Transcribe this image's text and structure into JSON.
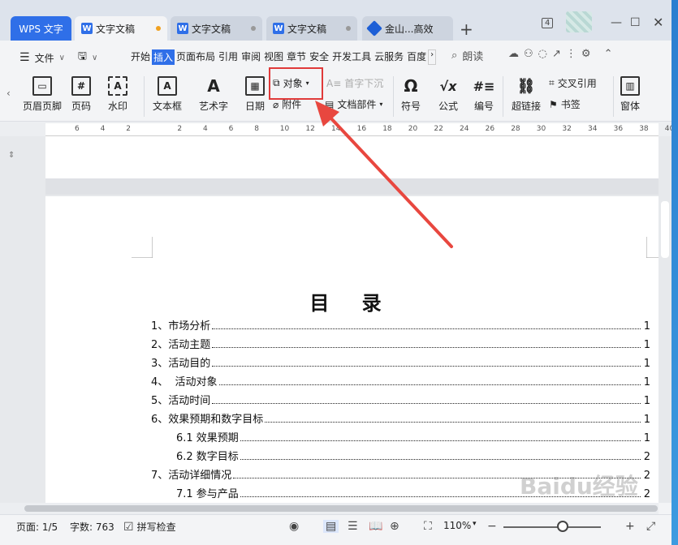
{
  "tabs": [
    {
      "label": "WPS 文字"
    },
    {
      "label": "文字文稿"
    },
    {
      "label": "文字文稿"
    },
    {
      "label": "文字文稿"
    },
    {
      "label": "金山...高效"
    }
  ],
  "titlebar": {
    "badge": "4"
  },
  "menu": {
    "file_label": "文件",
    "items": [
      "开始",
      "插入",
      "页面布局",
      "引用",
      "审阅",
      "视图",
      "章节",
      "安全",
      "开发工具",
      "云服务",
      "百度"
    ],
    "read_label": "朗读"
  },
  "ribbon": {
    "header_footer": "页眉页脚",
    "page_number": "页码",
    "watermark": "水印",
    "textbox": "文本框",
    "wordart": "艺术字",
    "date": "日期",
    "object": "对象",
    "attachment": "附件",
    "dropcap": "首字下沉",
    "doc_parts": "文档部件",
    "symbol": "符号",
    "formula": "公式",
    "numbering": "编号",
    "hyperlink": "超链接",
    "cross_ref": "交叉引用",
    "bookmark": "书签",
    "form": "窗体"
  },
  "ruler": {
    "labels": [
      "6",
      "4",
      "2",
      "",
      "2",
      "4",
      "6",
      "8",
      "10",
      "12",
      "14",
      "16",
      "18",
      "20",
      "22",
      "24",
      "26",
      "28",
      "30",
      "32",
      "34",
      "36",
      "38",
      "40"
    ]
  },
  "document": {
    "title": "目 录",
    "toc": [
      {
        "text": "1、市场分析",
        "page": "1",
        "indent": 0
      },
      {
        "text": "2、活动主题",
        "page": "1",
        "indent": 0
      },
      {
        "text": "3、活动目的",
        "page": "1",
        "indent": 0
      },
      {
        "text": "4、  活动对象",
        "page": "1",
        "indent": 0
      },
      {
        "text": "5、活动时间",
        "page": "1",
        "indent": 0
      },
      {
        "text": "6、效果预期和数字目标",
        "page": "1",
        "indent": 0
      },
      {
        "text": "6.1 效果预期",
        "page": "1",
        "indent": 1
      },
      {
        "text": "6.2 数字目标",
        "page": "2",
        "indent": 1
      },
      {
        "text": "7、活动详细情况",
        "page": "2",
        "indent": 0
      },
      {
        "text": "7.1 参与产品",
        "page": "2",
        "indent": 1
      }
    ]
  },
  "status": {
    "page": "页面: 1/5",
    "words": "字数: 763",
    "spellcheck": "拼写检查",
    "zoom": "110%"
  },
  "watermark_text": "Baidu经验",
  "colors": {
    "accent": "#2f6fe8",
    "annotation": "#e03a3a"
  }
}
